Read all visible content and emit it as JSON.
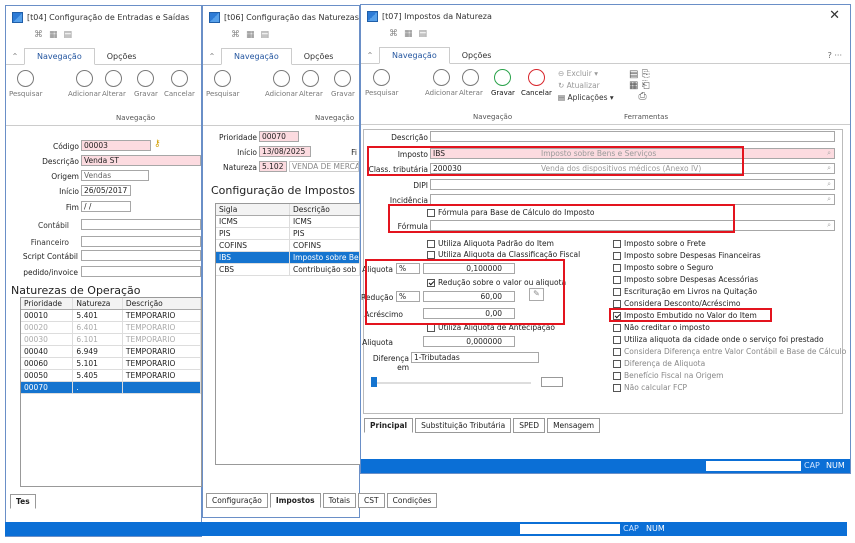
{
  "accent": "#0b6fd6",
  "highlight": "#e3141e",
  "w1": {
    "title": "[t04] Configuração de Entradas e Saídas",
    "tabs": [
      "Navegação",
      "Opções"
    ],
    "buttons": [
      "Pesquisar",
      "Adicionar",
      "Alterar",
      "Gravar",
      "Cancelar"
    ],
    "group": "Navegação",
    "labels": {
      "codigo": "Código",
      "descricao": "Descrição",
      "origem": "Origem",
      "inicio": "Início",
      "fim": "Fim",
      "contabil": "Contábil",
      "financeiro": "Financeiro",
      "script": "Script Contábil",
      "pedido": "pedido/invoice"
    },
    "values": {
      "codigo": "00003",
      "descricao": "Venda ST",
      "origem": "Vendas",
      "inicio": "26/05/2017",
      "fim": " / /"
    },
    "section": "Naturezas de Operação",
    "cols": [
      "Prioridade",
      "Natureza",
      "Descrição"
    ],
    "rows": [
      [
        "00010",
        "5.401",
        "TEMPORARIO"
      ],
      [
        "00020",
        "6.401",
        "TEMPORARIO"
      ],
      [
        "00030",
        "6.101",
        "TEMPORARIO"
      ],
      [
        "00040",
        "6.949",
        "TEMPORARIO"
      ],
      [
        "00060",
        "5.101",
        "TEMPORARIO"
      ],
      [
        "00050",
        "5.405",
        "TEMPORARIO"
      ],
      [
        "00070",
        ".",
        ""
      ]
    ],
    "bottom_tab": "Tes",
    "status": {
      "cap": "CAP",
      "num": "NUM"
    }
  },
  "w2": {
    "title": "[t06] Configuração das Naturezas",
    "tabs": [
      "Navegação",
      "Opções"
    ],
    "buttons": [
      "Pesquisar",
      "Adicionar",
      "Alterar",
      "Gravar"
    ],
    "group": "Navegação",
    "labels": {
      "prioridade": "Prioridade",
      "inicio": "Início",
      "natureza": "Natureza",
      "fim": "Fi"
    },
    "values": {
      "prioridade": "00070",
      "inicio": "13/08/2025",
      "natureza": "5.102",
      "natureza_desc": "VENDA DE MERCAD"
    },
    "section": "Configuração de Impostos",
    "cols": [
      "Sigla",
      "Descrição"
    ],
    "rows": [
      [
        "ICMS",
        "ICMS"
      ],
      [
        "PIS",
        "PIS"
      ],
      [
        "COFINS",
        "COFINS"
      ],
      [
        "IBS",
        "Imposto sobre Ben"
      ],
      [
        "CBS",
        "Contribuição sob"
      ]
    ],
    "tabs_bottom": [
      "Configuração",
      "Impostos",
      "Totais",
      "CST",
      "Condições"
    ]
  },
  "w3": {
    "title": "[t07] Impostos da Natureza",
    "tabs": [
      "Navegação",
      "Opções"
    ],
    "buttons": [
      "Pesquisar",
      "Adicionar",
      "Alterar",
      "Gravar",
      "Cancelar"
    ],
    "small": [
      "Excluir",
      "Atualizar",
      "Aplicações"
    ],
    "groups": [
      "Navegação",
      "Ferramentas"
    ],
    "labels": {
      "descricao": "Descrição",
      "imposto": "Imposto",
      "class": "Class. tributária",
      "dipi": "DIPI",
      "incidencia": "Incidência",
      "formula": "Fórmula",
      "aliquota": "Aliquota",
      "reducao": "Redução",
      "acrescimo": "Acréscimo",
      "aliquota2": "Aliquota",
      "diferenca": "Diferença em"
    },
    "values": {
      "imposto": "IBS",
      "imposto_desc": "Imposto sobre Bens e Serviços",
      "class": "200030",
      "class_desc": "Venda dos dispositivos médicos  (Anexo IV)",
      "aliq_unit": "%",
      "aliq": "0,100000",
      "red_unit": "%",
      "red": "60,00",
      "acr": "0,00",
      "aliq2": "0,000000",
      "diferenca": "1-Tributadas"
    },
    "formula_chk": "Fórmula para Base de Cálculo do Imposto",
    "left_checks": [
      {
        "t": "Utiliza Aliquota Padrão do Item",
        "c": false
      },
      {
        "t": "Utiliza Aliquota da Classificação Fiscal",
        "c": false
      }
    ],
    "red_chk": "Redução sobre o valor ou aliquota",
    "antecip_chk": "Utiliza Aliquota de Antecipação",
    "right_checks": [
      {
        "t": "Imposto sobre o Frete",
        "c": false
      },
      {
        "t": "Imposto sobre Despesas Financeiras",
        "c": false
      },
      {
        "t": "Imposto sobre o Seguro",
        "c": false
      },
      {
        "t": "Imposto sobre Despesas Acessórias",
        "c": false
      },
      {
        "t": "Escrituração em Livros na Quitação",
        "c": false
      },
      {
        "t": "Considera Desconto/Acréscimo",
        "c": false
      },
      {
        "t": "Imposto Embutido no Valor do Item",
        "c": true
      },
      {
        "t": "Não creditar o imposto",
        "c": false
      },
      {
        "t": "Utiliza aliquota da cidade onde o serviço foi prestado",
        "c": false
      },
      {
        "t": "Considera Diferença entre Valor Contábil e Base de Cálculo",
        "c": false
      },
      {
        "t": "Diferença de Aliquota",
        "c": false
      },
      {
        "t": "Benefício Fiscal na Origem",
        "c": false
      },
      {
        "t": "Não calcular FCP",
        "c": false
      }
    ],
    "bottom_tabs": [
      "Principal",
      "Substituição Tributária",
      "SPED",
      "Mensagem"
    ]
  }
}
